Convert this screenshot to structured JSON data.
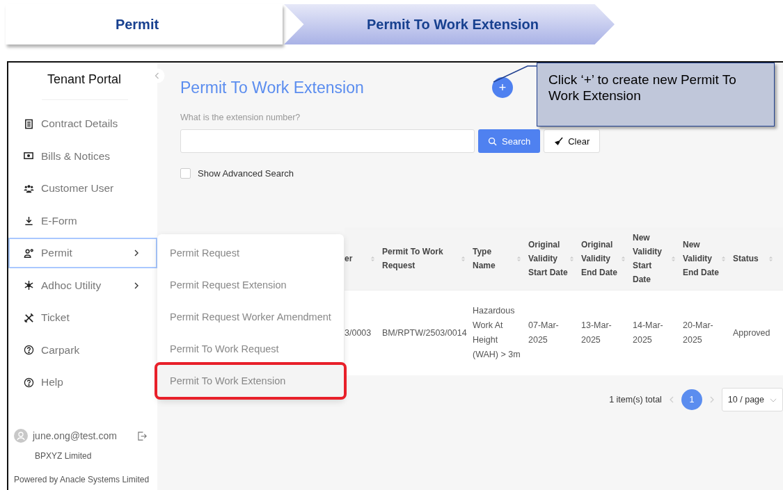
{
  "breadcrumb": [
    {
      "label": "Permit",
      "selected": false
    },
    {
      "label": "Permit To Work Extension",
      "selected": true
    }
  ],
  "sidebar": {
    "title": "Tenant Portal",
    "items": [
      {
        "label": "Contract Details",
        "has_submenu": false,
        "highlighted": false
      },
      {
        "label": "Bills & Notices",
        "has_submenu": false,
        "highlighted": false
      },
      {
        "label": "Customer User",
        "has_submenu": false,
        "highlighted": false
      },
      {
        "label": "E-Form",
        "has_submenu": false,
        "highlighted": false
      },
      {
        "label": "Permit",
        "has_submenu": true,
        "highlighted": true
      },
      {
        "label": "Adhoc Utility",
        "has_submenu": true,
        "highlighted": false
      },
      {
        "label": "Ticket",
        "has_submenu": false,
        "highlighted": false
      },
      {
        "label": "Carpark",
        "has_submenu": false,
        "highlighted": false
      },
      {
        "label": "Help",
        "has_submenu": false,
        "highlighted": false
      }
    ],
    "user": "june.ong@test.com",
    "company": "BPXYZ Limited",
    "footer": "Powered by Anacle Systems Limited"
  },
  "submenu": [
    {
      "label": "Permit Request",
      "highlighted": false
    },
    {
      "label": "Permit Request Extension",
      "highlighted": false
    },
    {
      "label": "Permit Request Worker Amendment",
      "highlighted": false
    },
    {
      "label": "Permit To Work Request",
      "highlighted": false
    },
    {
      "label": "Permit To Work Extension",
      "highlighted": true
    }
  ],
  "page": {
    "title": "Permit To Work Extension",
    "add_button": "+",
    "search_label": "What is the extension number?",
    "search_button": "Search",
    "clear_button": "Clear",
    "advanced_search": {
      "label": "Show Advanced Search",
      "checked": false
    }
  },
  "callout": "Click ‘+’ to create new Permit To Work Extension",
  "table": {
    "columns": [
      "er",
      "Permit To Work Request",
      "Type Name",
      "Original Validity Start Date",
      "Original Validity End Date",
      "New Validity Start Date",
      "New Validity End Date",
      "Status"
    ],
    "rows": [
      [
        "3/0003",
        "BM/RPTW/2503/0014",
        "Hazardous Work At Height (WAH) > 3m",
        "07-Mar-2025",
        "13-Mar-2025",
        "14-Mar-2025",
        "20-Mar-2025",
        "Approved"
      ]
    ]
  },
  "pagination": {
    "total": "1 item(s) total",
    "pages": [
      {
        "label": "1",
        "selected": true
      }
    ],
    "page_size": "10 / page"
  }
}
